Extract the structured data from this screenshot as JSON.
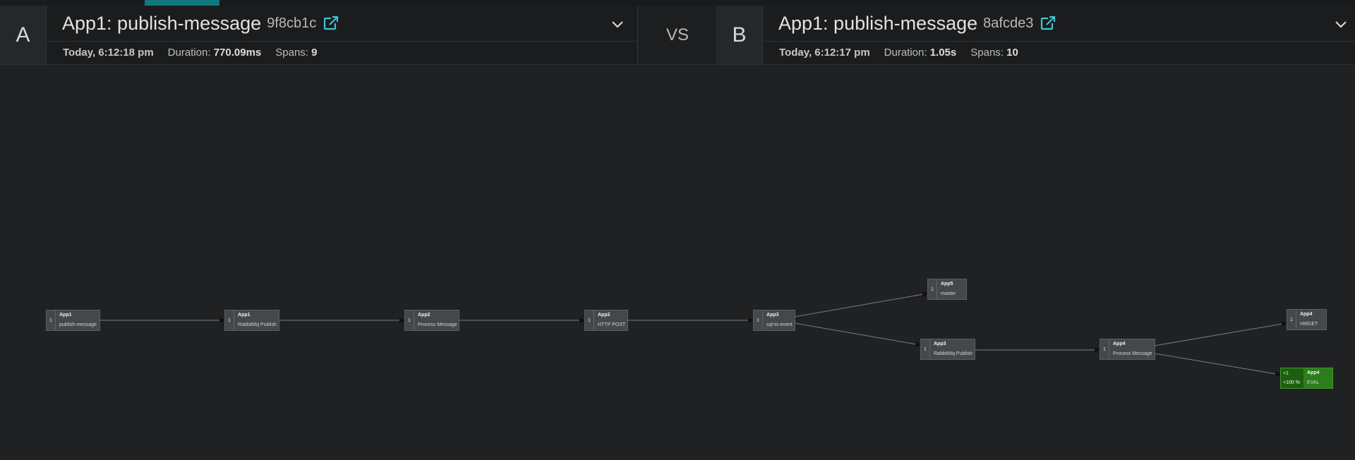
{
  "side_a": {
    "badge": "A",
    "title": "App1: publish-message",
    "trace_id": "9f8cb1c",
    "date": "Today, 6:12:18 pm",
    "duration_label": "Duration:",
    "duration": "770.09ms",
    "spans_label": "Spans:",
    "spans": "9"
  },
  "vs_label": "VS",
  "side_b": {
    "badge": "B",
    "title": "App1: publish-message",
    "trace_id": "8afcde3",
    "date": "Today, 6:12:17 pm",
    "duration_label": "Duration:",
    "duration": "1.05s",
    "spans_label": "Spans:",
    "spans": "10"
  },
  "icons": {
    "external_link": "external-link-icon",
    "chevron": "chevron-down-icon"
  },
  "colors": {
    "accent": "#3fc6d1",
    "added": "#2d7d1c"
  },
  "graph": {
    "nodes": [
      {
        "count": "1",
        "service": "App1",
        "operation": "publish-message"
      },
      {
        "count": "1",
        "service": "App1",
        "operation": "RabbitMq Publish"
      },
      {
        "count": "1",
        "service": "App2",
        "operation": "Process Message"
      },
      {
        "count": "1",
        "service": "App2",
        "operation": "HTTP POST"
      },
      {
        "count": "1",
        "service": "App3",
        "operation": "sql-to-event"
      },
      {
        "count": "1",
        "service": "App5",
        "operation": "master"
      },
      {
        "count": "1",
        "service": "App3",
        "operation": "RabbitMq Publish"
      },
      {
        "count": "1",
        "service": "App4",
        "operation": "Process Message"
      },
      {
        "count": "1",
        "service": "App4",
        "operation": "HMGET"
      },
      {
        "count": "+1",
        "pct": "+100 %",
        "service": "App4",
        "operation": "EVAL"
      }
    ]
  }
}
